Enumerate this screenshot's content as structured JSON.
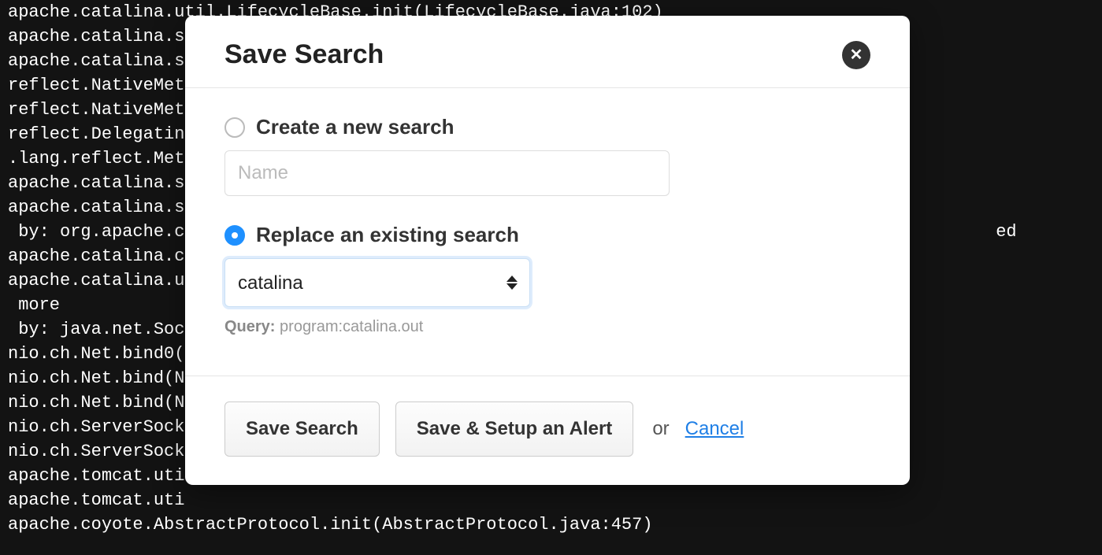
{
  "background": {
    "log_lines": [
      "apache.catalina.util.LifecycleBase.init(LifecycleBase.java:102)",
      "apache.catalina.s",
      "apache.catalina.s",
      "reflect.NativeMet",
      "reflect.NativeMet",
      "reflect.Delegatin",
      ".lang.reflect.Met",
      "apache.catalina.s",
      "apache.catalina.s",
      " by: org.apache.c                                                                              ed",
      "apache.catalina.c",
      "apache.catalina.u",
      " more",
      " by: java.net.Soc",
      "nio.ch.Net.bind0(",
      "nio.ch.Net.bind(N",
      "nio.ch.Net.bind(N",
      "nio.ch.ServerSock",
      "nio.ch.ServerSock",
      "apache.tomcat.uti",
      "apache.tomcat.uti",
      "apache.coyote.AbstractProtocol.init(AbstractProtocol.java:457)"
    ]
  },
  "modal": {
    "title": "Save Search",
    "option_create": {
      "label": "Create a new search",
      "selected": false,
      "name_placeholder": "Name",
      "name_value": ""
    },
    "option_replace": {
      "label": "Replace an existing search",
      "selected": true,
      "selected_option": "catalina",
      "query_label": "Query:",
      "query_value": "program:catalina.out"
    },
    "footer": {
      "save_label": "Save Search",
      "save_alert_label": "Save & Setup an Alert",
      "or_text": "or",
      "cancel_label": "Cancel"
    }
  }
}
